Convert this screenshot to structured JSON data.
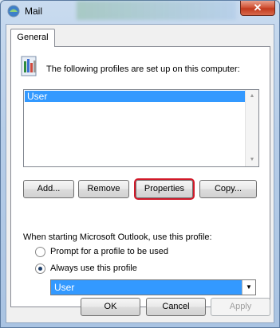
{
  "window": {
    "title": "Mail",
    "close_symbol": "✕"
  },
  "tabs": [
    {
      "label": "General",
      "selected": true
    }
  ],
  "intro_text": "The following profiles are set up on this computer:",
  "profiles": [
    {
      "name": "User",
      "selected": true
    }
  ],
  "profile_buttons": {
    "add": "Add...",
    "remove": "Remove",
    "properties": "Properties",
    "copy": "Copy..."
  },
  "startup": {
    "label": "When starting Microsoft Outlook, use this profile:",
    "options": [
      {
        "label": "Prompt for a profile to be used",
        "checked": false
      },
      {
        "label": "Always use this profile",
        "checked": true
      }
    ],
    "selected_profile": "User"
  },
  "footer_buttons": {
    "ok": "OK",
    "cancel": "Cancel",
    "apply": "Apply"
  },
  "colors": {
    "selection": "#3399ff",
    "highlight_box": "#d11a2a"
  }
}
